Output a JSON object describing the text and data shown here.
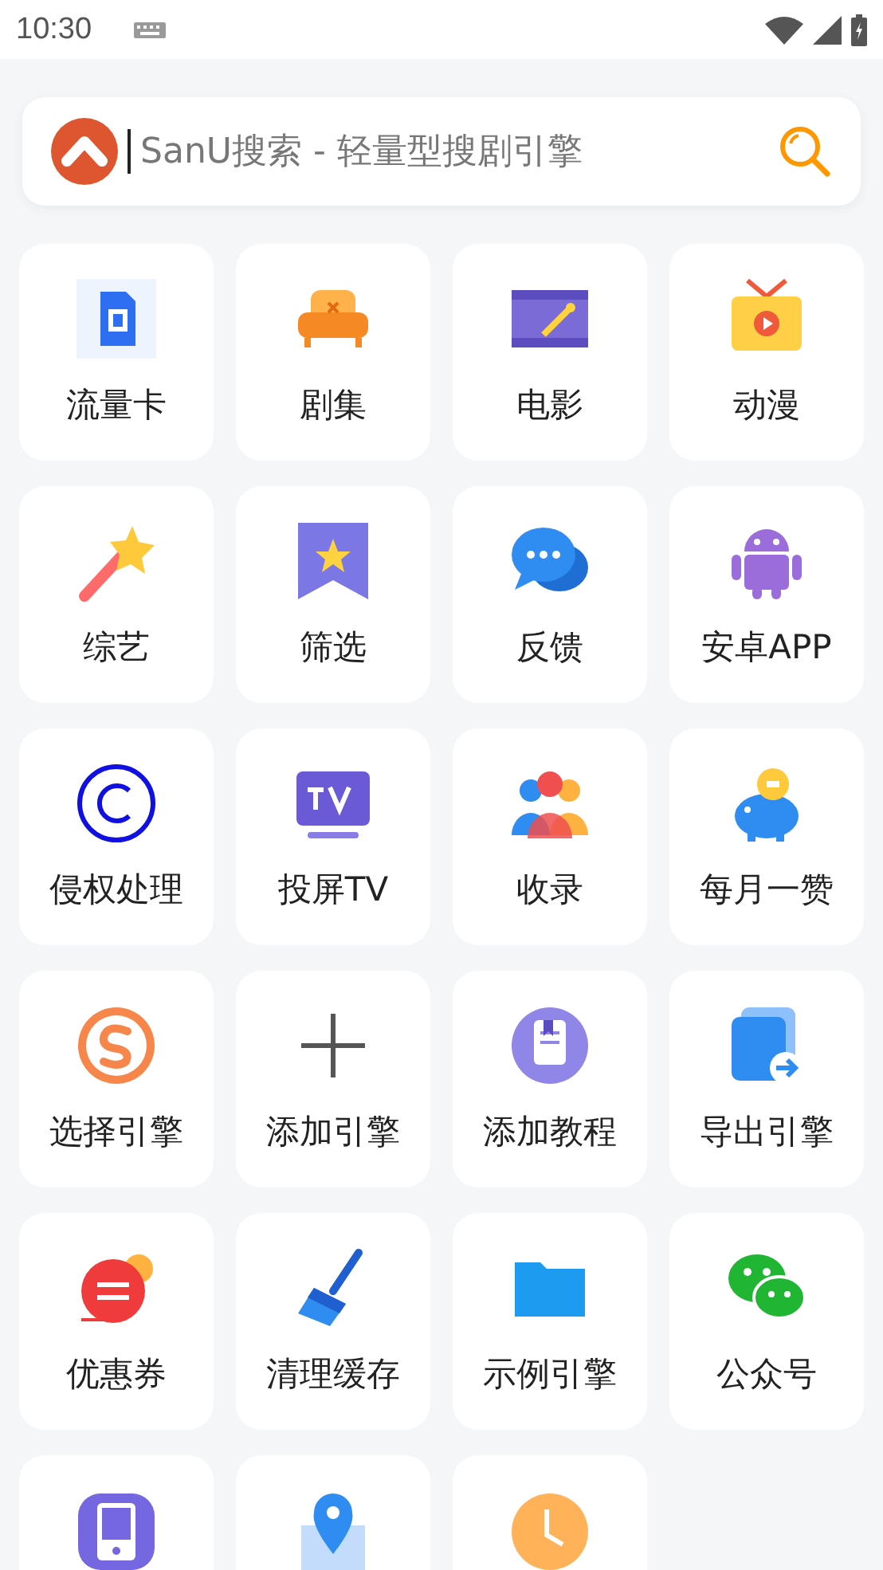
{
  "status_bar": {
    "time": "10:30"
  },
  "search": {
    "placeholder": "SanU搜索 - 轻量型搜剧引擎"
  },
  "tiles": [
    {
      "kind": "labeled",
      "label": "流量卡"
    },
    {
      "kind": "labeled",
      "label": "剧集"
    },
    {
      "kind": "labeled",
      "label": "电影"
    },
    {
      "kind": "labeled",
      "label": "动漫"
    },
    {
      "kind": "labeled",
      "label": "综艺"
    },
    {
      "kind": "labeled",
      "label": "筛选"
    },
    {
      "kind": "labeled",
      "label": "反馈"
    },
    {
      "kind": "labeled",
      "label": "安卓APP"
    },
    {
      "kind": "labeled",
      "label": "侵权处理"
    },
    {
      "kind": "labeled",
      "label": "投屏TV"
    },
    {
      "kind": "labeled",
      "label": "收录"
    },
    {
      "kind": "labeled",
      "label": "每月一赞"
    },
    {
      "kind": "labeled",
      "label": "选择引擎"
    },
    {
      "kind": "labeled",
      "label": "添加引擎"
    },
    {
      "kind": "labeled",
      "label": "添加教程"
    },
    {
      "kind": "labeled",
      "label": "导出引擎"
    },
    {
      "kind": "labeled",
      "label": "优惠券"
    },
    {
      "kind": "labeled",
      "label": "清理缓存"
    },
    {
      "kind": "labeled",
      "label": "示例引擎"
    },
    {
      "kind": "labeled",
      "label": "公众号"
    },
    {
      "kind": "icon_only"
    },
    {
      "kind": "icon_only"
    },
    {
      "kind": "icon_only"
    }
  ]
}
